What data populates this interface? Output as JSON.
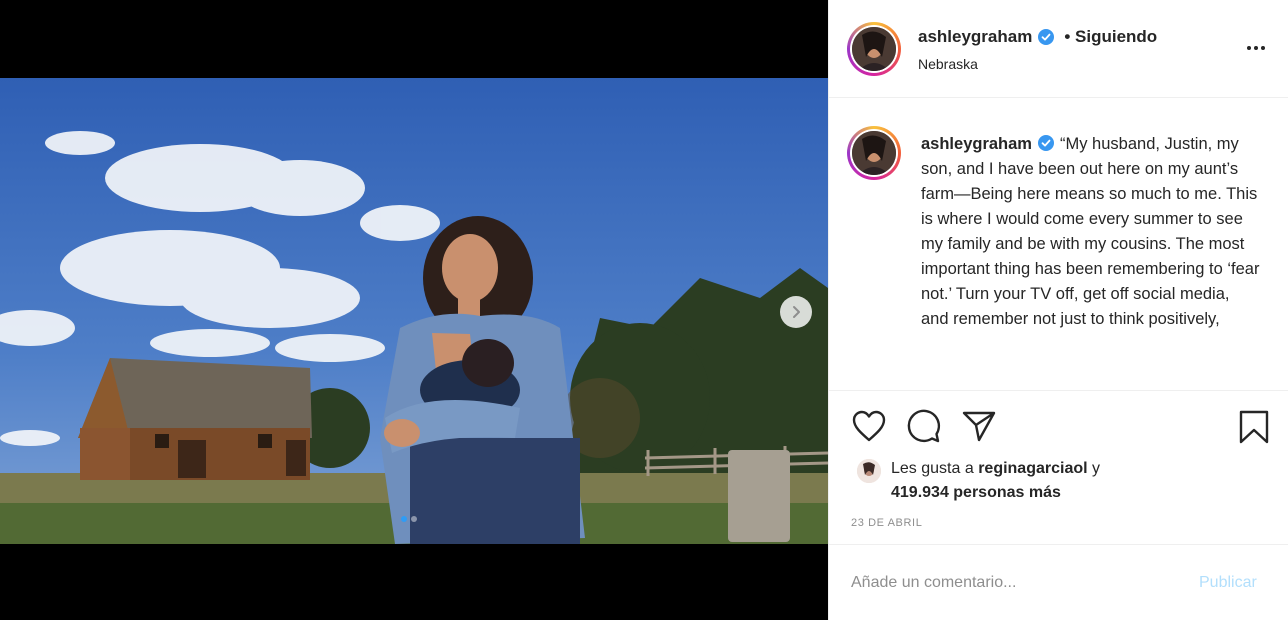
{
  "post": {
    "username": "ashleygraham",
    "follow_label": "• Siguiendo",
    "location": "Nebraska",
    "more_icon": "more-horizontal-icon",
    "caption_text": "“My husband, Justin, my son, and I have been out here on my aunt’s farm—Being here means so much to me. This is where I would come every summer to see my family and be with my cousins. The most important thing has been remembering to ‘fear not.’ Turn your TV off, get off social media, and remember not just to think positively,",
    "likes_prefix": "Les gusta a",
    "likes_user": "reginagarciaol",
    "likes_joiner": "y",
    "likes_count": "419.934 personas más",
    "date": "23 DE ABRIL",
    "comment_placeholder": "Añade un comentario...",
    "publish_label": "Publicar"
  },
  "carousel": {
    "slide_index": 1,
    "slide_count": 2,
    "next_icon": "chevron-right-icon"
  },
  "icons": {
    "like": "heart-icon",
    "comment": "comment-icon",
    "share": "paper-plane-icon",
    "save": "bookmark-icon",
    "verified": "verified-badge-icon"
  },
  "colors": {
    "verified_blue": "#3897f0",
    "publish_disabled": "#b2dffc",
    "muted_text": "#8e8e8e",
    "sky": "#3e6cb8"
  }
}
